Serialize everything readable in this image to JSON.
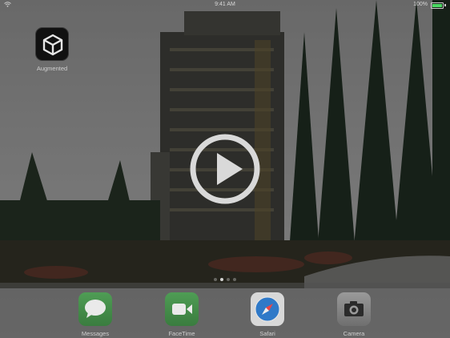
{
  "status_bar": {
    "time": "9:41 AM",
    "battery_percent": "100%",
    "battery_level": 1.0,
    "wifi_icon": "wifi-icon"
  },
  "home_apps": [
    {
      "label": "Augmented",
      "icon": "unity-icon"
    }
  ],
  "dock": {
    "apps": [
      {
        "label": "Messages",
        "icon": "messages-icon"
      },
      {
        "label": "FaceTime",
        "icon": "facetime-icon"
      },
      {
        "label": "Safari",
        "icon": "safari-icon"
      },
      {
        "label": "Camera",
        "icon": "camera-icon"
      }
    ]
  },
  "page_indicator": {
    "count": 4,
    "active": 1
  },
  "video_overlay": {
    "icon": "play-icon"
  },
  "colors": {
    "battery": "#4cd964",
    "app_green": "#4a9650",
    "overlay_white": "#d9d9d9"
  }
}
